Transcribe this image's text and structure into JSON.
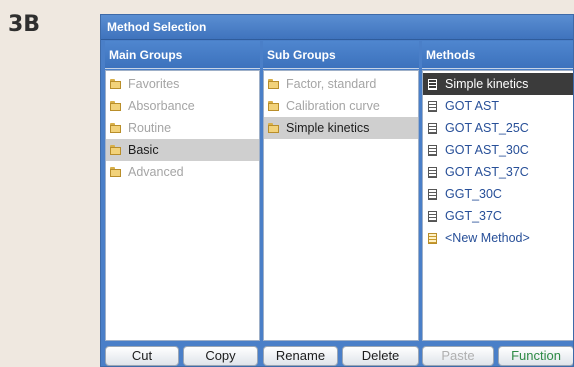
{
  "figure_label": "3B",
  "window": {
    "title": "Method Selection"
  },
  "columns": {
    "main": {
      "header": "Main Groups",
      "items": [
        {
          "label": "Favorites",
          "state": "gray"
        },
        {
          "label": "Absorbance",
          "state": "gray"
        },
        {
          "label": "Routine",
          "state": "gray"
        },
        {
          "label": "Basic",
          "state": "selected"
        },
        {
          "label": "Advanced",
          "state": "gray"
        }
      ]
    },
    "sub": {
      "header": "Sub Groups",
      "items": [
        {
          "label": "Factor, standard",
          "state": "gray"
        },
        {
          "label": "Calibration curve",
          "state": "gray"
        },
        {
          "label": "Simple kinetics",
          "state": "selected"
        }
      ]
    },
    "methods": {
      "header": "Methods",
      "items": [
        {
          "label": "Simple kinetics",
          "state": "selected"
        },
        {
          "label": "GOT AST",
          "state": "normal"
        },
        {
          "label": "GOT AST_25C",
          "state": "normal"
        },
        {
          "label": "GOT AST_30C",
          "state": "normal"
        },
        {
          "label": "GOT AST_37C",
          "state": "normal"
        },
        {
          "label": "GGT_30C",
          "state": "normal"
        },
        {
          "label": "GGT_37C",
          "state": "normal"
        },
        {
          "label": "<New Method>",
          "state": "new"
        }
      ]
    }
  },
  "buttons": {
    "cut": "Cut",
    "copy": "Copy",
    "rename": "Rename",
    "delete": "Delete",
    "paste": "Paste",
    "function": "Function"
  },
  "colors": {
    "window_blue": "#4a7fc8",
    "function_green": "#2e8a45",
    "method_blue": "#274f98"
  },
  "icons": {
    "group_item": "folder-icon",
    "method_item": "document-icon",
    "new_method": "new-document-icon"
  }
}
